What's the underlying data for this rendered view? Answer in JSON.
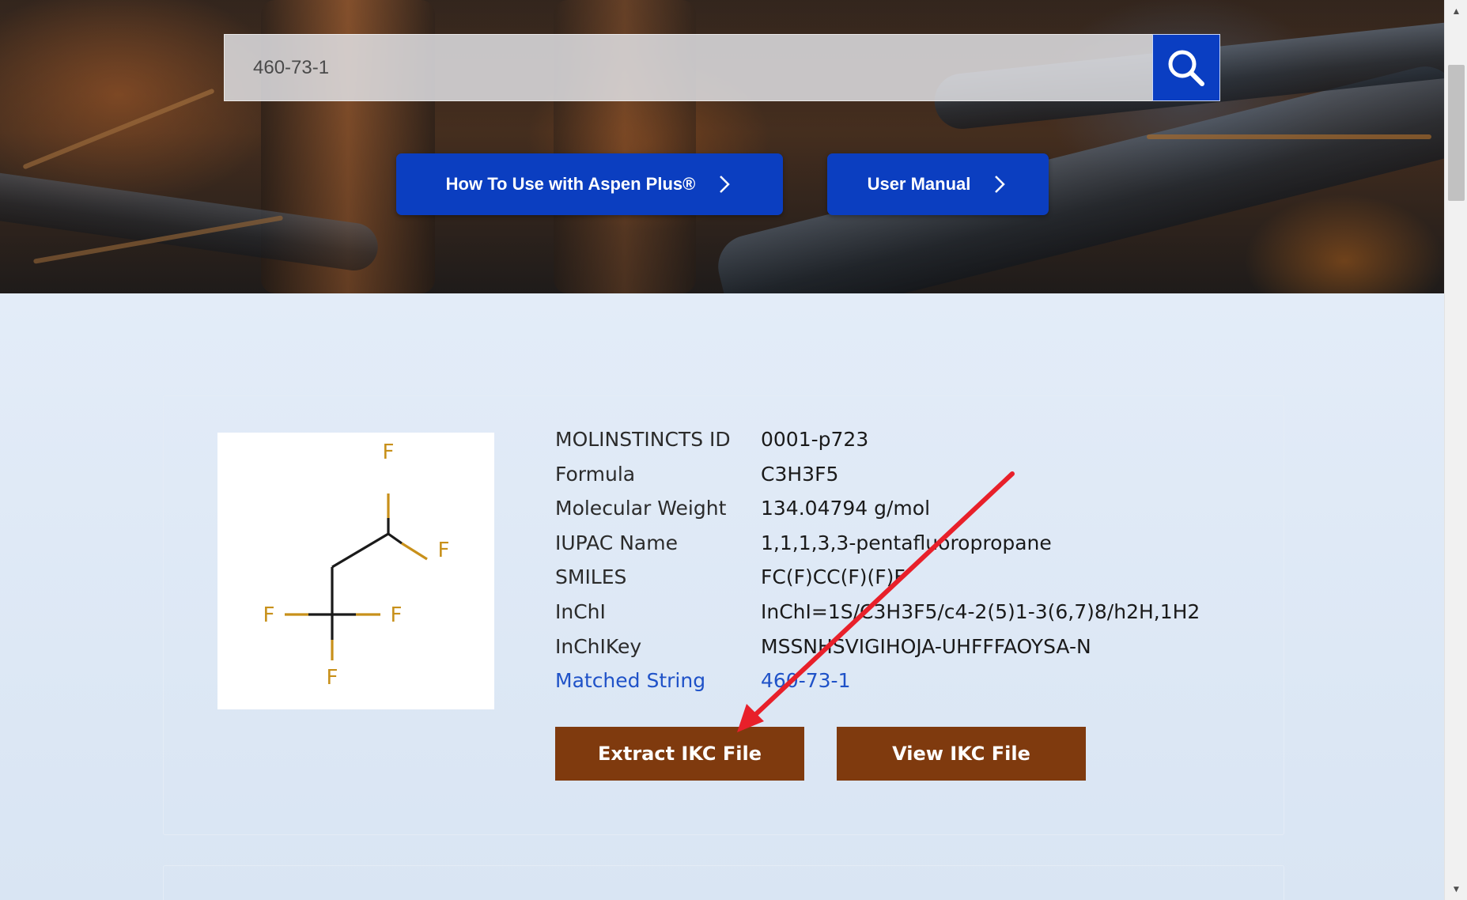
{
  "search": {
    "value": "460-73-1"
  },
  "hero_buttons": {
    "aspen": "How To Use with Aspen Plus®",
    "manual": "User Manual"
  },
  "structure": {
    "atoms": [
      "F",
      "F",
      "F",
      "F",
      "F"
    ]
  },
  "properties": [
    {
      "label": "MOLINSTINCTS ID",
      "value": "0001-p723"
    },
    {
      "label": "Formula",
      "value": "C3H3F5"
    },
    {
      "label": "Molecular Weight",
      "value": "134.04794 g/mol"
    },
    {
      "label": "IUPAC Name",
      "value": "1,1,1,3,3-pentafluoropropane"
    },
    {
      "label": "SMILES",
      "value": "FC(F)CC(F)(F)F"
    },
    {
      "label": "InChI",
      "value": "InChI=1S/C3H3F5/c4-2(5)1-3(6,7)8/h2H,1H2"
    },
    {
      "label": "InChIKey",
      "value": "MSSNHSVIGIHOJA-UHFFFAOYSA-N"
    },
    {
      "label": "Matched String",
      "value": "460-73-1"
    }
  ],
  "actions": {
    "extract": "Extract IKC File",
    "view": "View IKC File"
  },
  "colors": {
    "hero_button": "#0b3ec0",
    "ikc_button": "#7f3a0e",
    "link": "#1f52c8",
    "annotation_arrow": "#e8202a",
    "fluorine": "#c8901a"
  }
}
